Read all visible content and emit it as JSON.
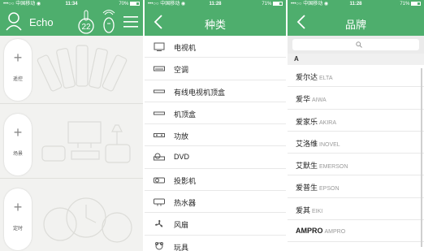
{
  "colors": {
    "brand": "#4eae6d",
    "card_bg": "#f2f2f0"
  },
  "status_bars": [
    {
      "carrier": "•••○○ 中国移动 ◉",
      "time": "11:34",
      "battery": "70%"
    },
    {
      "carrier": "•••○○ 中国移动 ◉",
      "time": "11:28",
      "battery": "71%"
    },
    {
      "carrier": "•••○○ 中国移动 ◉",
      "time": "11:28",
      "battery": "71%"
    }
  ],
  "home": {
    "app_name": "Echo",
    "temperature": "22",
    "cards": [
      {
        "label": "遥控",
        "plus": "+"
      },
      {
        "label": "场景",
        "plus": "+"
      },
      {
        "label": "定时",
        "plus": "+"
      }
    ]
  },
  "categories": {
    "title": "种类",
    "items": [
      {
        "label": "电视机",
        "icon": "tv-icon"
      },
      {
        "label": "空调",
        "icon": "air-conditioner-icon"
      },
      {
        "label": "有线电视机顶盒",
        "icon": "cable-box-icon"
      },
      {
        "label": "机顶盒",
        "icon": "set-top-box-icon"
      },
      {
        "label": "功放",
        "icon": "amplifier-icon"
      },
      {
        "label": "DVD",
        "icon": "dvd-icon"
      },
      {
        "label": "投影机",
        "icon": "projector-icon"
      },
      {
        "label": "热水器",
        "icon": "water-heater-icon"
      },
      {
        "label": "风扇",
        "icon": "fan-icon"
      },
      {
        "label": "玩具",
        "icon": "toy-icon"
      }
    ]
  },
  "brands": {
    "title": "品牌",
    "search_placeholder": "",
    "section": "A",
    "items": [
      {
        "zh": "爱尔达",
        "en": "ELTA"
      },
      {
        "zh": "爱华",
        "en": "AIWA"
      },
      {
        "zh": "爱家乐",
        "en": "AKIRA"
      },
      {
        "zh": "艾洛维",
        "en": "INOVEL"
      },
      {
        "zh": "艾默生",
        "en": "EMERSON"
      },
      {
        "zh": "爱普生",
        "en": "EPSON"
      },
      {
        "zh": "爱其",
        "en": "EIKI"
      },
      {
        "zh": "AMPRO",
        "en": "AMPRO"
      }
    ]
  }
}
